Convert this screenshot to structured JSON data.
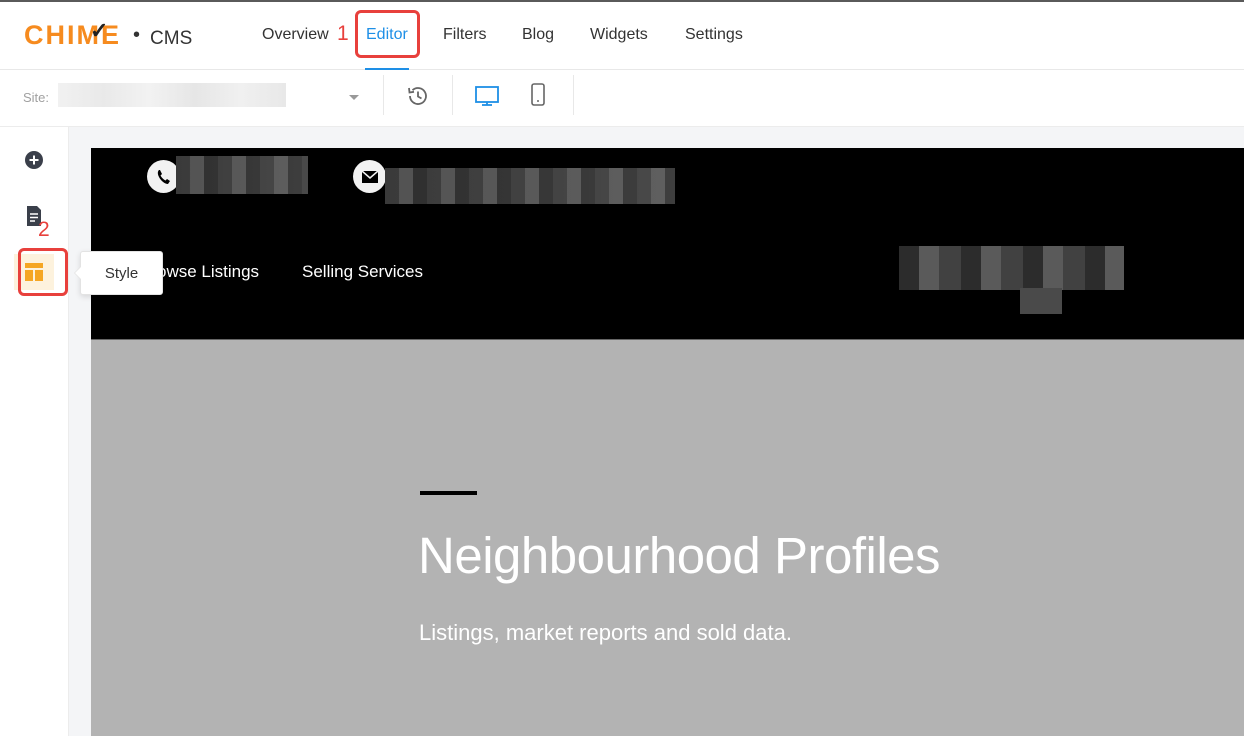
{
  "app": {
    "brand": "CHIME",
    "separator": "•",
    "product": "CMS"
  },
  "nav": {
    "items": [
      {
        "label": "Overview",
        "active": false
      },
      {
        "label": "Editor",
        "active": true
      },
      {
        "label": "Filters",
        "active": false
      },
      {
        "label": "Blog",
        "active": false
      },
      {
        "label": "Widgets",
        "active": false
      },
      {
        "label": "Settings",
        "active": false
      }
    ]
  },
  "annotations": {
    "step1": "1",
    "step2": "2"
  },
  "toolbar": {
    "site_label": "Site:",
    "icons": [
      "history-icon",
      "desktop-icon",
      "mobile-icon"
    ]
  },
  "rail": {
    "items": [
      {
        "icon": "add-circle-icon"
      },
      {
        "icon": "page-icon"
      },
      {
        "icon": "style-layout-icon",
        "active": true
      }
    ],
    "tooltip": "Style"
  },
  "preview": {
    "nav": [
      "owse Listings",
      "Selling Services"
    ],
    "hero_title": "Neighbourhood Profiles",
    "hero_subtitle": "Listings, market reports and sold data."
  },
  "colors": {
    "brand_orange": "#f68b1f",
    "accent_blue": "#1e8fe6",
    "annotation_red": "#e8403c",
    "style_icon_orange": "#f5a623"
  }
}
